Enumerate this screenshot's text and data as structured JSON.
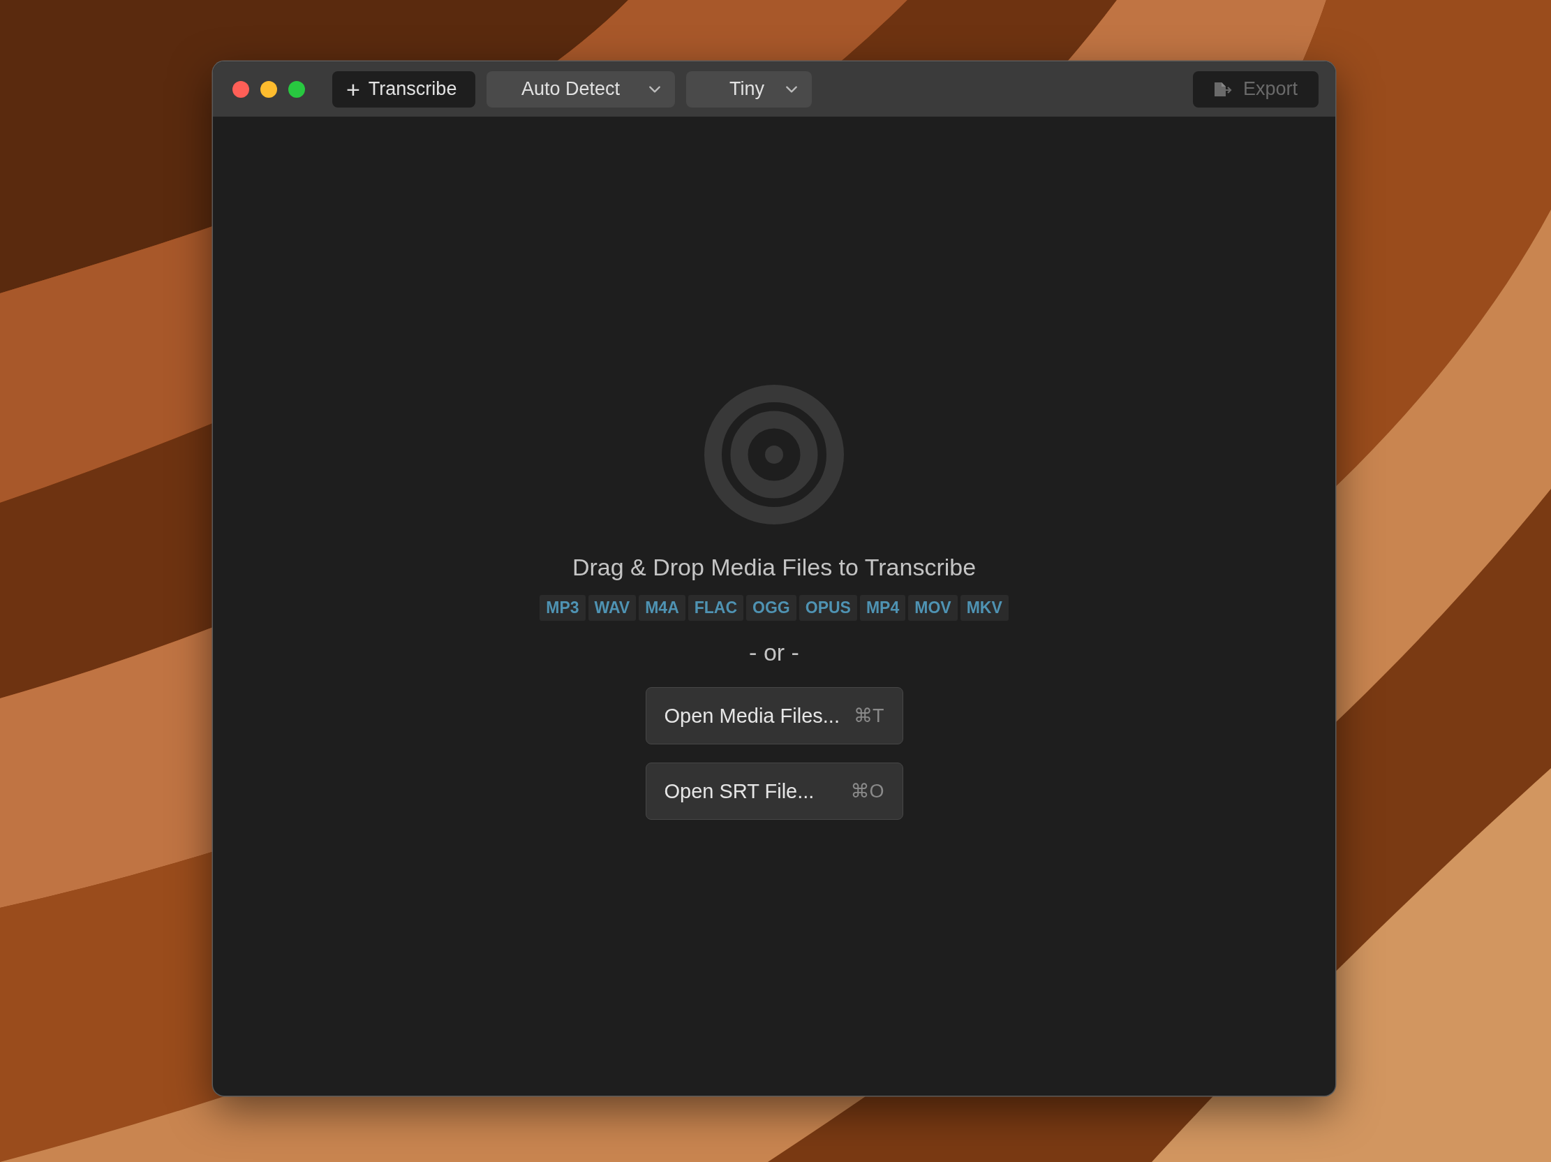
{
  "window": {
    "traffic_lights": [
      {
        "color": "#ff5f57"
      },
      {
        "color": "#febc2e"
      },
      {
        "color": "#28c840"
      }
    ],
    "toolbar": [
      {
        "kind": "button",
        "icon": "+",
        "label": "Transcribe",
        "disabled": false
      },
      {
        "kind": "dropdown",
        "label": "Auto Detect",
        "disabled": false
      },
      {
        "kind": "dropdown",
        "label": "Tiny",
        "disabled": false
      },
      {
        "kind": "spacer"
      },
      {
        "kind": "export",
        "label": "Export",
        "disabled": true
      }
    ]
  },
  "drop_zone": {
    "title": "Drag & Drop Media Files to Transcribe",
    "formats": [
      "MP3",
      "WAV",
      "M4A",
      "FLAC",
      "OGG",
      "OPUS",
      "MP4",
      "MOV",
      "MKV"
    ],
    "separator": "- or -",
    "actions": [
      {
        "label": "Open Media Files...",
        "shortcut": "⌘T"
      },
      {
        "label": "Open SRT File...",
        "shortcut": "⌘O"
      }
    ]
  }
}
